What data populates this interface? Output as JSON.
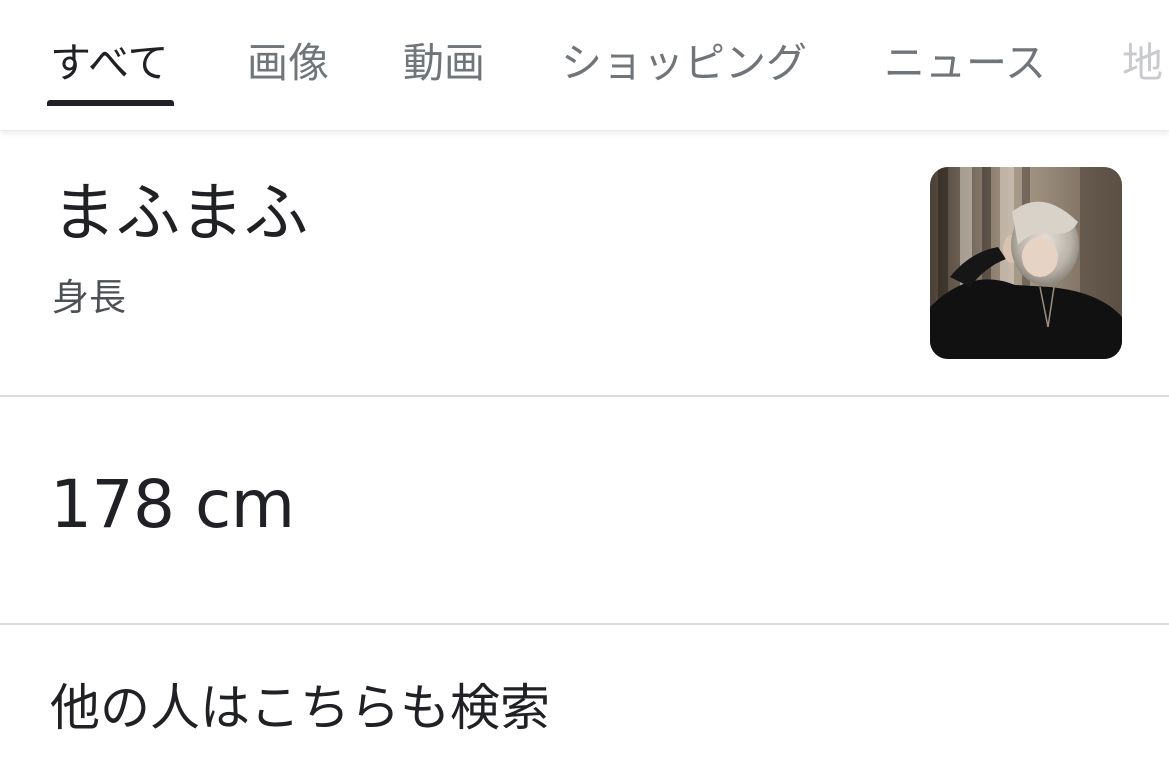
{
  "tabs": [
    {
      "label": "すべて",
      "active": true
    },
    {
      "label": "画像"
    },
    {
      "label": "動画"
    },
    {
      "label": "ショッピング"
    },
    {
      "label": "ニュース"
    },
    {
      "label": "地"
    }
  ],
  "entity": {
    "title": "まふまふ",
    "subtitle": "身長"
  },
  "answer": {
    "value": "178 cm"
  },
  "related": {
    "heading": "他の人はこちらも検索"
  },
  "colors": {
    "text_primary": "#202124",
    "text_secondary": "#70757a",
    "divider": "#dadce0",
    "tab_indicator": "#202124"
  }
}
